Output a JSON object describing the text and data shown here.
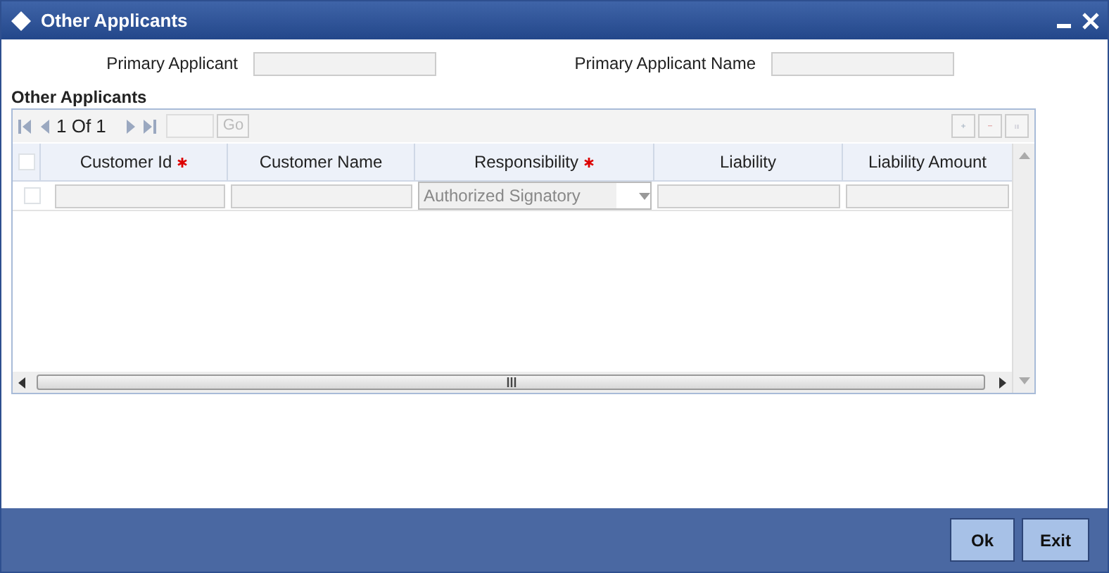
{
  "window": {
    "title": "Other Applicants"
  },
  "fields": [
    {
      "label": "Primary Applicant"
    },
    {
      "label": "Primary Applicant Name"
    }
  ],
  "section_title": "Other Applicants",
  "pager": {
    "text": "1 Of 1",
    "go": "Go"
  },
  "table": {
    "select_all_checked": false,
    "columns": [
      {
        "label": "Customer Id",
        "required": true
      },
      {
        "label": "Customer Name",
        "required": false
      },
      {
        "label": "Responsibility",
        "required": true
      },
      {
        "label": "Liability",
        "required": false
      },
      {
        "label": "Liability Amount",
        "required": false
      }
    ],
    "rows": [
      {
        "checked": false,
        "responsibility": "Authorized Signatory"
      }
    ]
  },
  "buttons": [
    "Ok",
    "Exit"
  ]
}
